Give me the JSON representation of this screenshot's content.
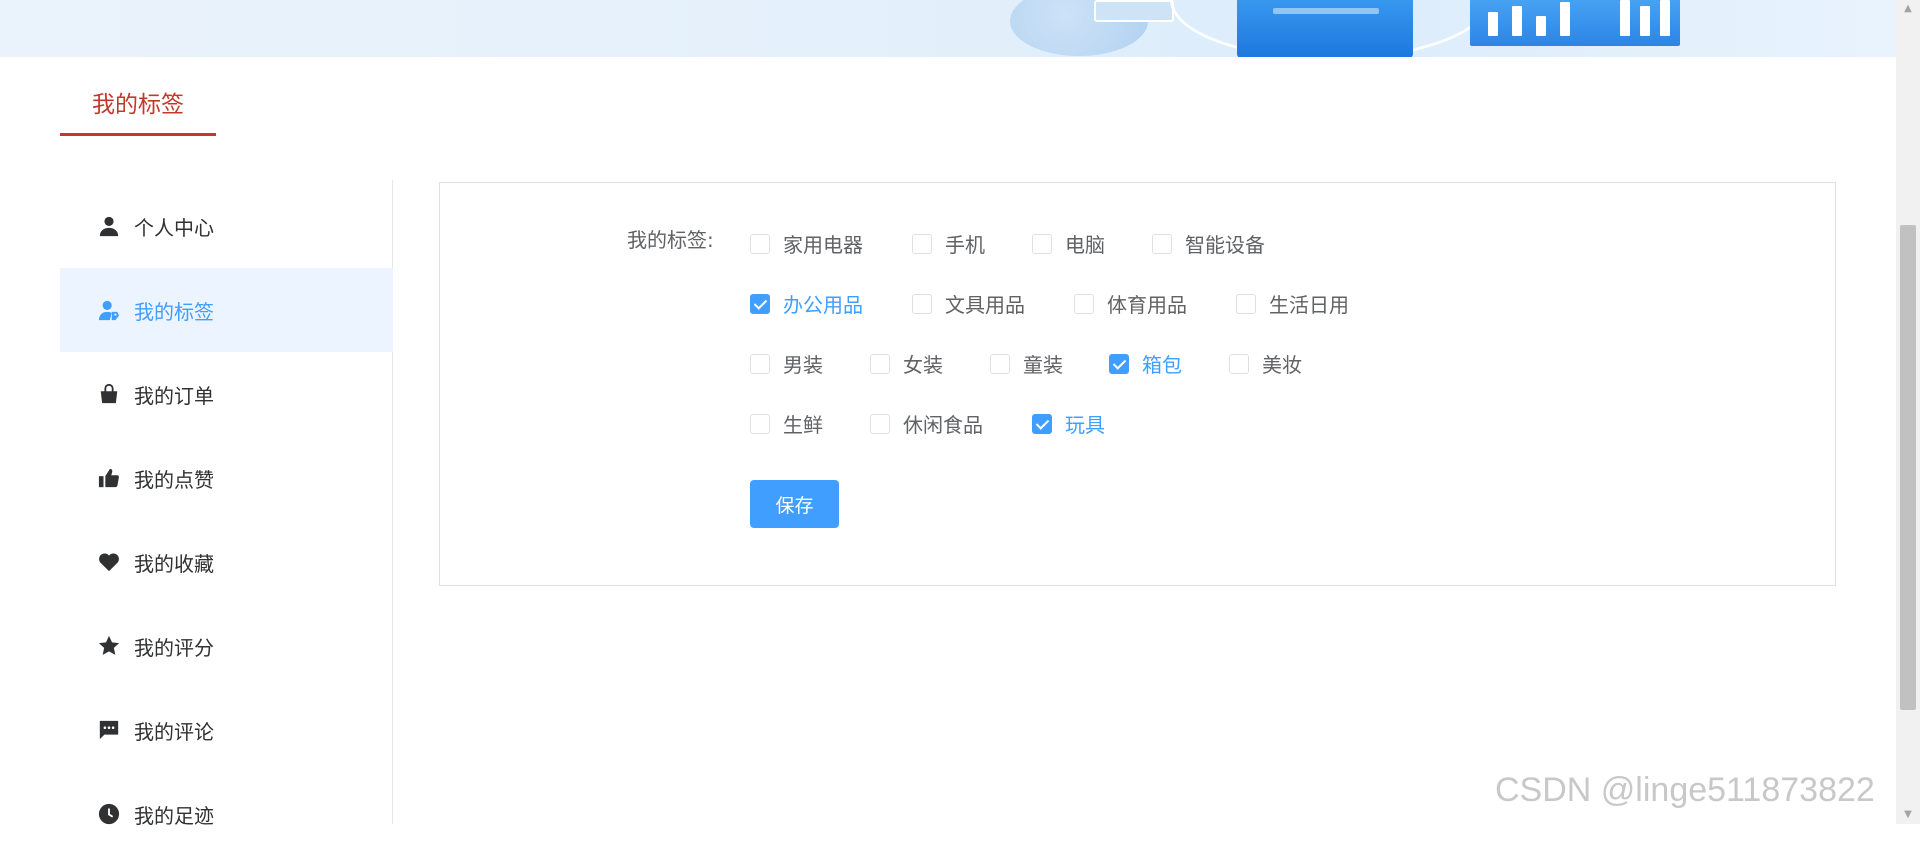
{
  "page_title": "我的标签",
  "sidebar": {
    "items": [
      {
        "label": "个人中心",
        "icon": "user-icon",
        "active": false
      },
      {
        "label": "我的标签",
        "icon": "user-tag-icon",
        "active": true
      },
      {
        "label": "我的订单",
        "icon": "shopping-bag-icon",
        "active": false
      },
      {
        "label": "我的点赞",
        "icon": "thumbs-up-icon",
        "active": false
      },
      {
        "label": "我的收藏",
        "icon": "heart-icon",
        "active": false
      },
      {
        "label": "我的评分",
        "icon": "star-icon",
        "active": false
      },
      {
        "label": "我的评论",
        "icon": "comment-icon",
        "active": false
      },
      {
        "label": "我的足迹",
        "icon": "clock-icon",
        "active": false
      }
    ]
  },
  "form": {
    "label": "我的标签:",
    "tags": [
      {
        "label": "家用电器",
        "checked": false
      },
      {
        "label": "手机",
        "checked": false
      },
      {
        "label": "电脑",
        "checked": false
      },
      {
        "label": "智能设备",
        "checked": false
      },
      {
        "label": "办公用品",
        "checked": true
      },
      {
        "label": "文具用品",
        "checked": false
      },
      {
        "label": "体育用品",
        "checked": false
      },
      {
        "label": "生活日用",
        "checked": false
      },
      {
        "label": "男装",
        "checked": false
      },
      {
        "label": "女装",
        "checked": false
      },
      {
        "label": "童装",
        "checked": false
      },
      {
        "label": "箱包",
        "checked": true
      },
      {
        "label": "美妆",
        "checked": false
      },
      {
        "label": "生鲜",
        "checked": false
      },
      {
        "label": "休闲食品",
        "checked": false
      },
      {
        "label": "玩具",
        "checked": true
      }
    ],
    "save_label": "保存"
  },
  "watermark": "CSDN @linge511873822",
  "colors": {
    "accent": "#409eff",
    "title_red": "#c0392b",
    "active_bg": "#ecf5ff"
  }
}
